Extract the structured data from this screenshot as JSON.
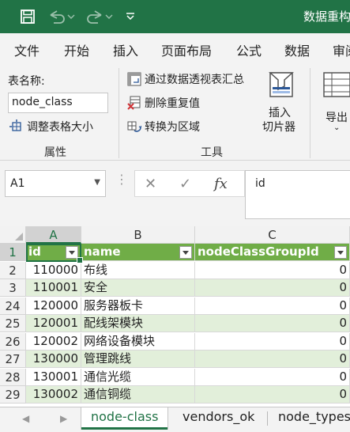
{
  "titlebar": {
    "title": "数据重构"
  },
  "tabs": [
    "文件",
    "开始",
    "插入",
    "页面布局",
    "公式",
    "数据",
    "审阅"
  ],
  "ribbon": {
    "table_name_label": "表名称:",
    "table_name_value": "node_class",
    "resize_table": "调整表格大小",
    "group_properties": "属性",
    "summarize_pivot": "通过数据透视表汇总",
    "remove_duplicates": "删除重复值",
    "convert_to_range": "转换为区域",
    "insert_slicer_line1": "插入",
    "insert_slicer_line2": "切片器",
    "group_tools": "工具",
    "export": "导出"
  },
  "formula_bar": {
    "name_box": "A1",
    "formula": "id",
    "fx": "fx"
  },
  "columns": [
    "A",
    "B",
    "C"
  ],
  "header": [
    "id",
    "name",
    "nodeClassGroupId"
  ],
  "rows": [
    {
      "row": "2",
      "id": "110000",
      "name": "布线",
      "group": "0"
    },
    {
      "row": "3",
      "id": "110001",
      "name": "安全",
      "group": "0"
    },
    {
      "row": "24",
      "id": "120000",
      "name": "服务器板卡",
      "group": "0"
    },
    {
      "row": "25",
      "id": "120001",
      "name": "配线架模块",
      "group": "0"
    },
    {
      "row": "26",
      "id": "120002",
      "name": "网络设备模块",
      "group": "0"
    },
    {
      "row": "27",
      "id": "130000",
      "name": "管理跳线",
      "group": "0"
    },
    {
      "row": "28",
      "id": "130001",
      "name": "通信光缆",
      "group": "0"
    },
    {
      "row": "29",
      "id": "130002",
      "name": "通信铜缆",
      "group": "0"
    }
  ],
  "header_row_number": "1",
  "sheets": [
    "node-class",
    "vendors_ok",
    "node_types"
  ],
  "colors": {
    "excel_green": "#217346",
    "table_header": "#70ad47",
    "band": "#e2efda"
  }
}
